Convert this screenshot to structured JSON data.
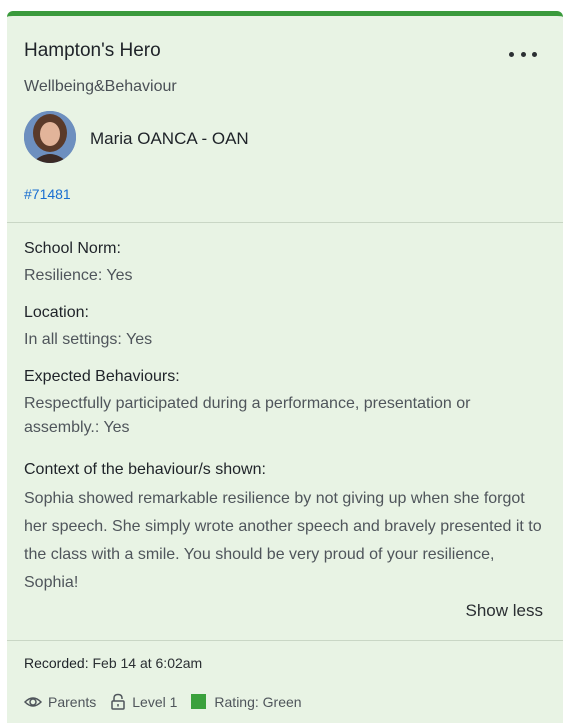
{
  "card": {
    "title": "Hampton's Hero",
    "category": "Wellbeing&Behaviour",
    "author": "Maria OANCA - OAN",
    "reference": "#71481",
    "accent_color": "#3a9a3c",
    "background_color": "#e8f3e4"
  },
  "details": {
    "school_norm_label": "School Norm:",
    "school_norm_value": "Resilience: Yes",
    "location_label": "Location:",
    "location_value": "In all settings: Yes",
    "expected_label": "Expected Behaviours:",
    "expected_value": "Respectfully participated during a performance, presentation or assembly.: Yes",
    "context_label": "Context of the behaviour/s shown:",
    "context_value": "Sophia showed remarkable resilience by not giving up when she forgot her speech. She simply wrote another speech and bravely presented it to the class with a smile. You should be very proud of your resilience, Sophia!",
    "toggle_label": "Show less"
  },
  "footer": {
    "recorded_label": "Recorded:",
    "recorded_value": "Feb 14 at 6:02am",
    "visibility": "Parents",
    "level": "Level 1",
    "rating": "Rating: Green",
    "rating_color": "#3aa13c"
  },
  "icons": [
    "more-icon",
    "eye-icon",
    "lock-icon",
    "rating-swatch-icon"
  ]
}
